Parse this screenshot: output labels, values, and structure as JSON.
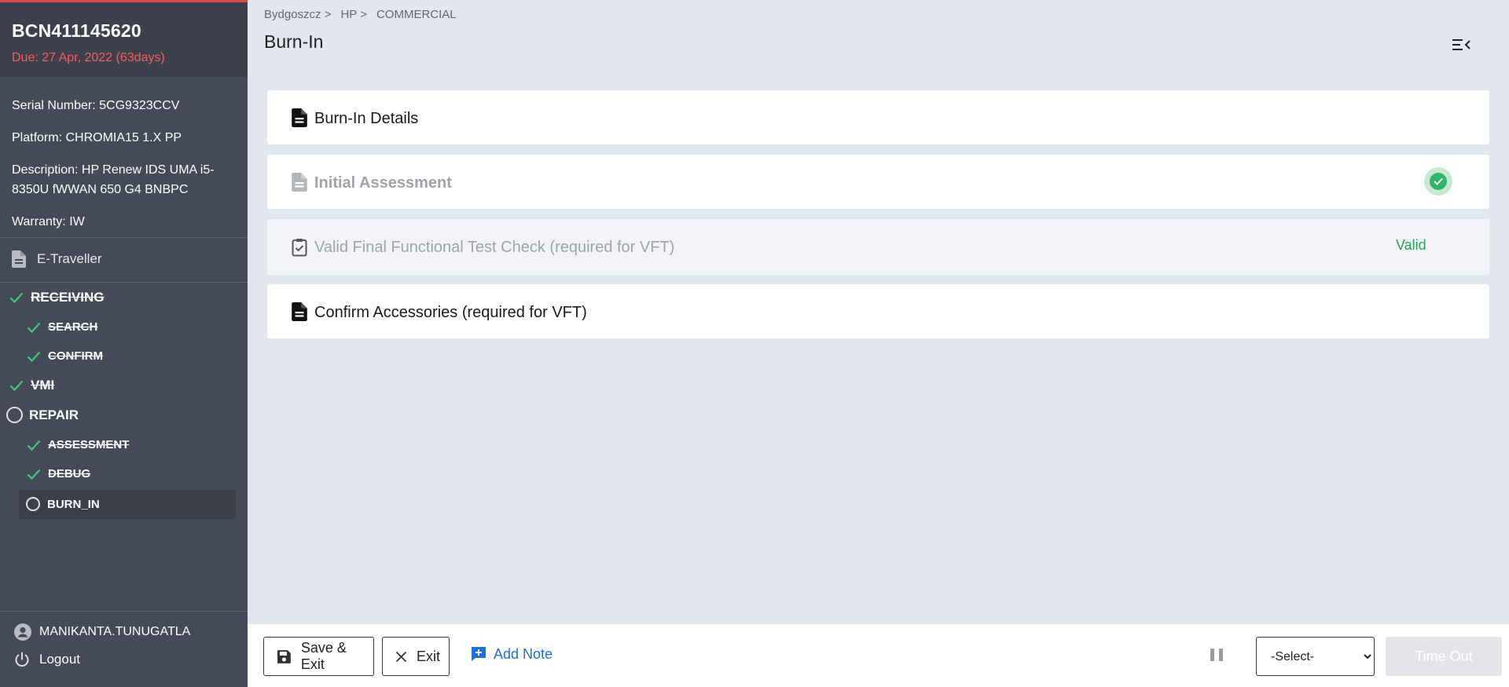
{
  "sidebar": {
    "title": "BCN411145620",
    "due": "Due: 27 Apr, 2022 (63days)",
    "info": {
      "serial": "Serial Number: 5CG9323CCV",
      "platform": "Platform: CHROMIA15 1.X PP",
      "description_l1": "Description: HP Renew IDS UMA i5-",
      "description_l2": "8350U fWWAN 650 G4 BNBPC",
      "warranty": "Warranty: IW"
    },
    "e_traveller": "E-Traveller",
    "nav": {
      "receiving": "RECEIVING",
      "search": "SEARCH",
      "confirm": "CONFIRM",
      "vmi": "VMI",
      "repair": "REPAIR",
      "assessment": "ASSESSMENT",
      "debug": "DEBUG",
      "burn_in": "BURN_IN"
    },
    "user": "MANIKANTA.TUNUGATLA",
    "logout": "Logout"
  },
  "breadcrumb": [
    "Bydgoszcz >",
    "HP >",
    "COMMERCIAL"
  ],
  "page_title": "Burn-In",
  "cards": {
    "burn_in_details": "Burn-In Details",
    "initial_assessment": "Initial Assessment",
    "vft_check": "Valid Final Functional Test Check (required for VFT)",
    "vft_status": "Valid",
    "confirm_accessories": "Confirm Accessories (required for VFT)"
  },
  "footer": {
    "save_exit": "Save & Exit",
    "exit": "Exit",
    "add_note": "Add Note",
    "select_value": "-Select-",
    "time_out": "Time Out"
  },
  "colors": {
    "sidebar_bg": "#444a57",
    "accent_red": "#e04848",
    "success_green": "#2fb567",
    "link_blue": "#1c6fd8"
  }
}
